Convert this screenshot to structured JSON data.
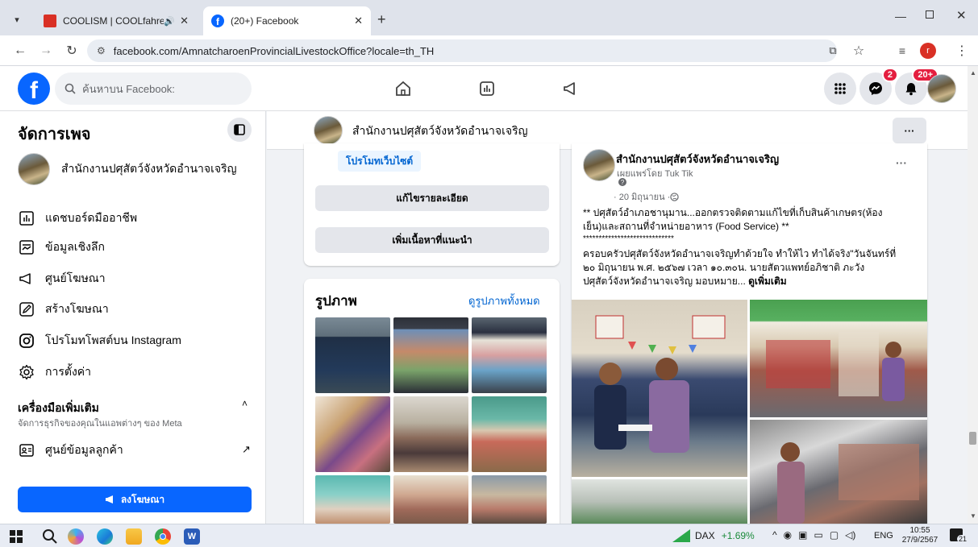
{
  "browser": {
    "tabs": [
      {
        "title": "COOLISM | COOLfahrenheit"
      },
      {
        "title": "(20+) Facebook"
      }
    ],
    "url": "facebook.com/AmnatcharoenProvincialLivestockOffice?locale=th_TH"
  },
  "fb": {
    "search_placeholder": "ค้นหาบน Facebook:",
    "messenger_badge": "2",
    "notif_badge": "20+"
  },
  "sidebar": {
    "title": "จัดการเพจ",
    "page_name": "สำนักงานปศุสัตว์จังหวัดอำนาจเจริญ",
    "items": [
      {
        "label": "แดชบอร์ดมืออาชีพ"
      },
      {
        "label": "ข้อมูลเชิงลึก"
      },
      {
        "label": "ศูนย์โฆษณา"
      },
      {
        "label": "สร้างโฆษณา"
      },
      {
        "label": "โปรโมทโพสต์บน Instagram"
      },
      {
        "label": "การตั้งค่า"
      }
    ],
    "tools_title": "เครื่องมือเพิ่มเติม",
    "tools_sub": "จัดการธุรกิจของคุณในแอพต่างๆ ของ Meta",
    "tools_item": "ศูนย์ข้อมูลลูกค้า",
    "ad_button": "ลงโฆษณา"
  },
  "pagebar": {
    "name": "สำนักงานปศุสัตว์จังหวัดอำนาจเจริญ",
    "more": "···"
  },
  "leftcol": {
    "promote_web": "โปรโมทเว็บไซต์",
    "edit_details": "แก้ไขรายละเอียด",
    "add_content": "เพิ่มเนื้อหาที่แนะนำ",
    "photos_title": "รูปภาพ",
    "see_all_photos": "ดูรูปภาพทั้งหมด"
  },
  "post": {
    "author": "สำนักงานปศุสัตว์จังหวัดอำนาจเจริญ",
    "published_by": "เผยแพร่โดย Tuk Tik",
    "date": "· 20 มิถุนายน · ",
    "more": "···",
    "line1": "** ปศุสัตว์อำเภอชานุมาน...ออกตรวจติดตามแก้ไขที่เก็บสินค้าเกษตร(ห้อง",
    "line2": "เย็น)และสถานที่จำหน่ายอาหาร (Food Service) **",
    "line3": "*****************************",
    "line4": "ครอบครัวปศุสัตว์จังหวัดอำนาจเจริญทำด้วยใจ  ทำให้ไว  ทำได้จริง\"วันจันทร์ที่",
    "line5": "๒๐ มิถุนายน พ.ศ. ๒๕๖๗ เวลา ๑๐.๓๐น. นายสัตวแพทย์อภิชาติ ภะวัง",
    "line6": "ปศุสัตว์จังหวัดอำนาจเจริญ มอบหมาย... ",
    "see_more": "ดูเพิ่มเติม"
  },
  "taskbar": {
    "stock_name": "DAX",
    "stock_change": "+1.69%",
    "lang": "ENG",
    "time": "10:55",
    "date": "27/9/2567",
    "notif": "21"
  }
}
